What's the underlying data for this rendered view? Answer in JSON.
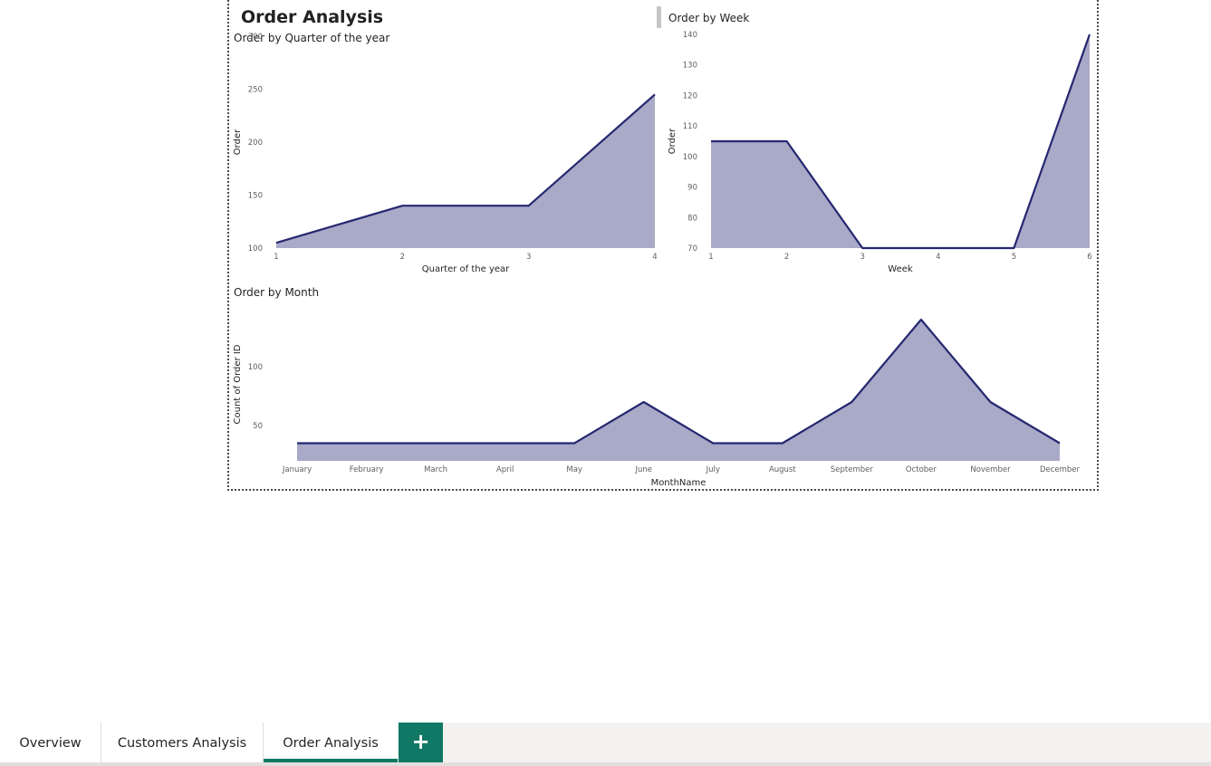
{
  "report": {
    "title": "Order Analysis"
  },
  "colors": {
    "area_fill": "#a9a9c8",
    "line": "#252870",
    "tab_accent": "#117865"
  },
  "tabs": [
    {
      "label": "Overview",
      "active": false
    },
    {
      "label": "Customers Analysis",
      "active": false
    },
    {
      "label": "Order Analysis",
      "active": true
    }
  ],
  "add_tab": {
    "label": "+",
    "icon": "plus-icon"
  },
  "chart_data": [
    {
      "type": "area",
      "title": "Order by Quarter of the year",
      "xlabel": "Quarter of the year",
      "ylabel": "Order",
      "x": [
        "1",
        "2",
        "3",
        "4"
      ],
      "values": [
        105,
        140,
        140,
        245
      ],
      "ylim": [
        100,
        300
      ],
      "yticks": [
        100,
        150,
        200,
        250,
        300
      ],
      "grid": false
    },
    {
      "type": "area",
      "title": "Order by Week",
      "xlabel": "Week",
      "ylabel": "Order",
      "x": [
        "1",
        "2",
        "3",
        "4",
        "5",
        "6"
      ],
      "values": [
        105,
        105,
        70,
        70,
        70,
        140
      ],
      "ylim": [
        70,
        140
      ],
      "yticks": [
        70,
        80,
        90,
        100,
        110,
        120,
        130,
        140
      ],
      "grid": false
    },
    {
      "type": "area",
      "title": "Order by Month",
      "xlabel": "MonthName",
      "ylabel": "Count of Order ID",
      "x": [
        "January",
        "February",
        "March",
        "April",
        "May",
        "June",
        "July",
        "August",
        "September",
        "October",
        "November",
        "December"
      ],
      "values": [
        35,
        35,
        35,
        35,
        35,
        70,
        35,
        35,
        70,
        140,
        70,
        35
      ],
      "ylim": [
        20,
        150
      ],
      "yticks": [
        50,
        100
      ],
      "grid": false
    }
  ]
}
